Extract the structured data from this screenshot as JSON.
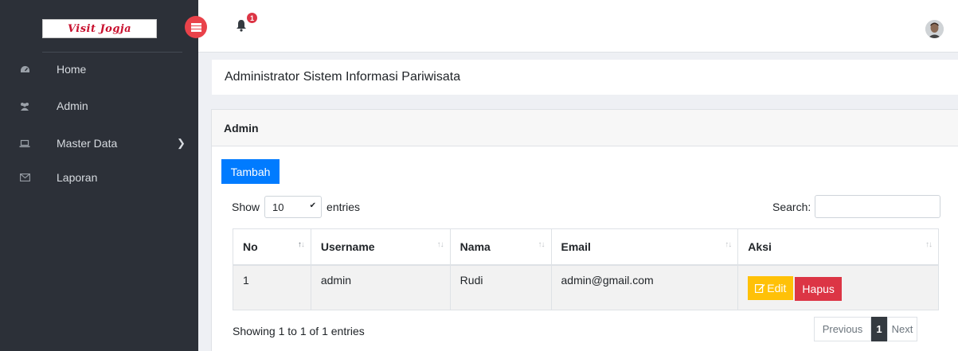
{
  "brand": {
    "logo_text": "Visit Jogja"
  },
  "sidebar": {
    "items": [
      {
        "label": "Home",
        "icon": "dashboard-icon"
      },
      {
        "label": "Admin",
        "icon": "users-icon"
      },
      {
        "label": "Master Data",
        "icon": "laptop-icon",
        "has_submenu": true
      },
      {
        "label": "Laporan",
        "icon": "envelope-icon"
      }
    ]
  },
  "topbar": {
    "notification_count": "1"
  },
  "page": {
    "title": "Administrator Sistem Informasi Pariwisata"
  },
  "card": {
    "header": "Admin",
    "add_button": "Tambah",
    "show_label": "Show",
    "entries_label": "entries",
    "length_value": "10",
    "search_label": "Search:",
    "search_value": ""
  },
  "table": {
    "columns": [
      "No",
      "Username",
      "Nama",
      "Email",
      "Aksi"
    ],
    "rows": [
      {
        "no": "1",
        "username": "admin",
        "nama": "Rudi",
        "email": "admin@gmail.com",
        "edit_label": "Edit",
        "delete_label": "Hapus"
      }
    ]
  },
  "footer": {
    "info": "Showing 1 to 1 of 1 entries",
    "previous": "Previous",
    "current_page": "1",
    "next": "Next"
  },
  "colors": {
    "sidebar_bg": "#2c3038",
    "primary": "#007bff",
    "warning": "#ffc107",
    "danger": "#dc3545",
    "toggle": "#e9424a"
  }
}
